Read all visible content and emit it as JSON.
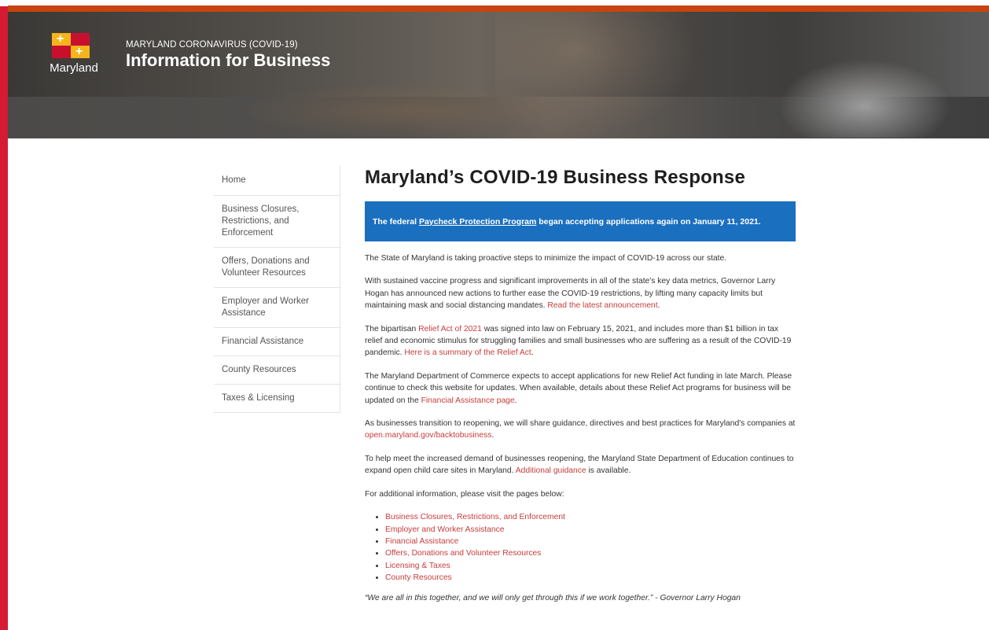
{
  "header": {
    "logo_text": "Maryland",
    "subtitle": "MARYLAND CORONAVIRUS (COVID-19)",
    "title": "Information for Business"
  },
  "nav": {
    "items": [
      {
        "label": "Home"
      },
      {
        "label": "Business Closures, Restrictions, and Enforcement"
      },
      {
        "label": "Offers, Donations and Volunteer Resources"
      },
      {
        "label": "Employer and Worker Assistance"
      },
      {
        "label": "Financial Assistance"
      },
      {
        "label": "County Resources"
      },
      {
        "label": "Taxes & Licensing"
      }
    ]
  },
  "main": {
    "title": "Maryland’s COVID-19 Business Response",
    "alert": {
      "pre": "The federal ",
      "link": "Paycheck Protection Program",
      "post": " began accepting applications again on January 11, 2021."
    },
    "p1": "The State of Maryland is taking proactive steps to minimize the impact of COVID-19 across our state.",
    "p2": {
      "text": "With sustained vaccine progress and significant improvements in all of the state's key data metrics, Governor Larry Hogan has announced new actions to further ease the COVID-19 restrictions, by lifting many capacity limits but maintaining mask and social distancing mandates. ",
      "link": "Read the latest announcement",
      "post": "."
    },
    "p3": {
      "pre": "The bipartisan ",
      "link1": "Relief Act of 2021",
      "mid": " was signed into law on February 15, 2021, and includes more than $1 billion in tax relief and economic stimulus for struggling families and small businesses who are suffering as a result of the COVID-19 pandemic. ",
      "link2": "Here is a summary of the Relief Act",
      "post": "."
    },
    "p4": {
      "text": "The Maryland Department of Commerce expects to accept applications for new Relief Act funding in late March.  Please continue to check this website for updates. When available, details about these Relief Act programs for business will be updated on the ",
      "link": "Financial Assistance page",
      "post": "."
    },
    "p5": {
      "text": "As businesses transition to reopening, we will share guidance, directives and best practices for Maryland's companies at ",
      "link": "open.maryland.gov/backtobusiness",
      "post": "."
    },
    "p6": {
      "text": "To help meet the increased demand of businesses reopening, the Maryland State Department of Education continues to expand open child care sites in Maryland. ",
      "link": "Additional guidance",
      "post": " is available."
    },
    "p7": "For additional information, please visit the pages below:",
    "links": [
      "Business Closures, Restrictions, and Enforcement",
      "Employer and Worker Assistance",
      "Financial Assistance",
      "Offers, Donations and Volunteer Resources",
      "Licensing & Taxes",
      "County Resources"
    ],
    "quote": "“We are all in this together, and we will only get through this if we work together.” - Governor Larry Hogan"
  },
  "colors": {
    "accent_red": "#d41b31",
    "accent_orange": "#c8430f",
    "alert_blue": "#1b6fbf",
    "link_red": "#c73c3c"
  }
}
